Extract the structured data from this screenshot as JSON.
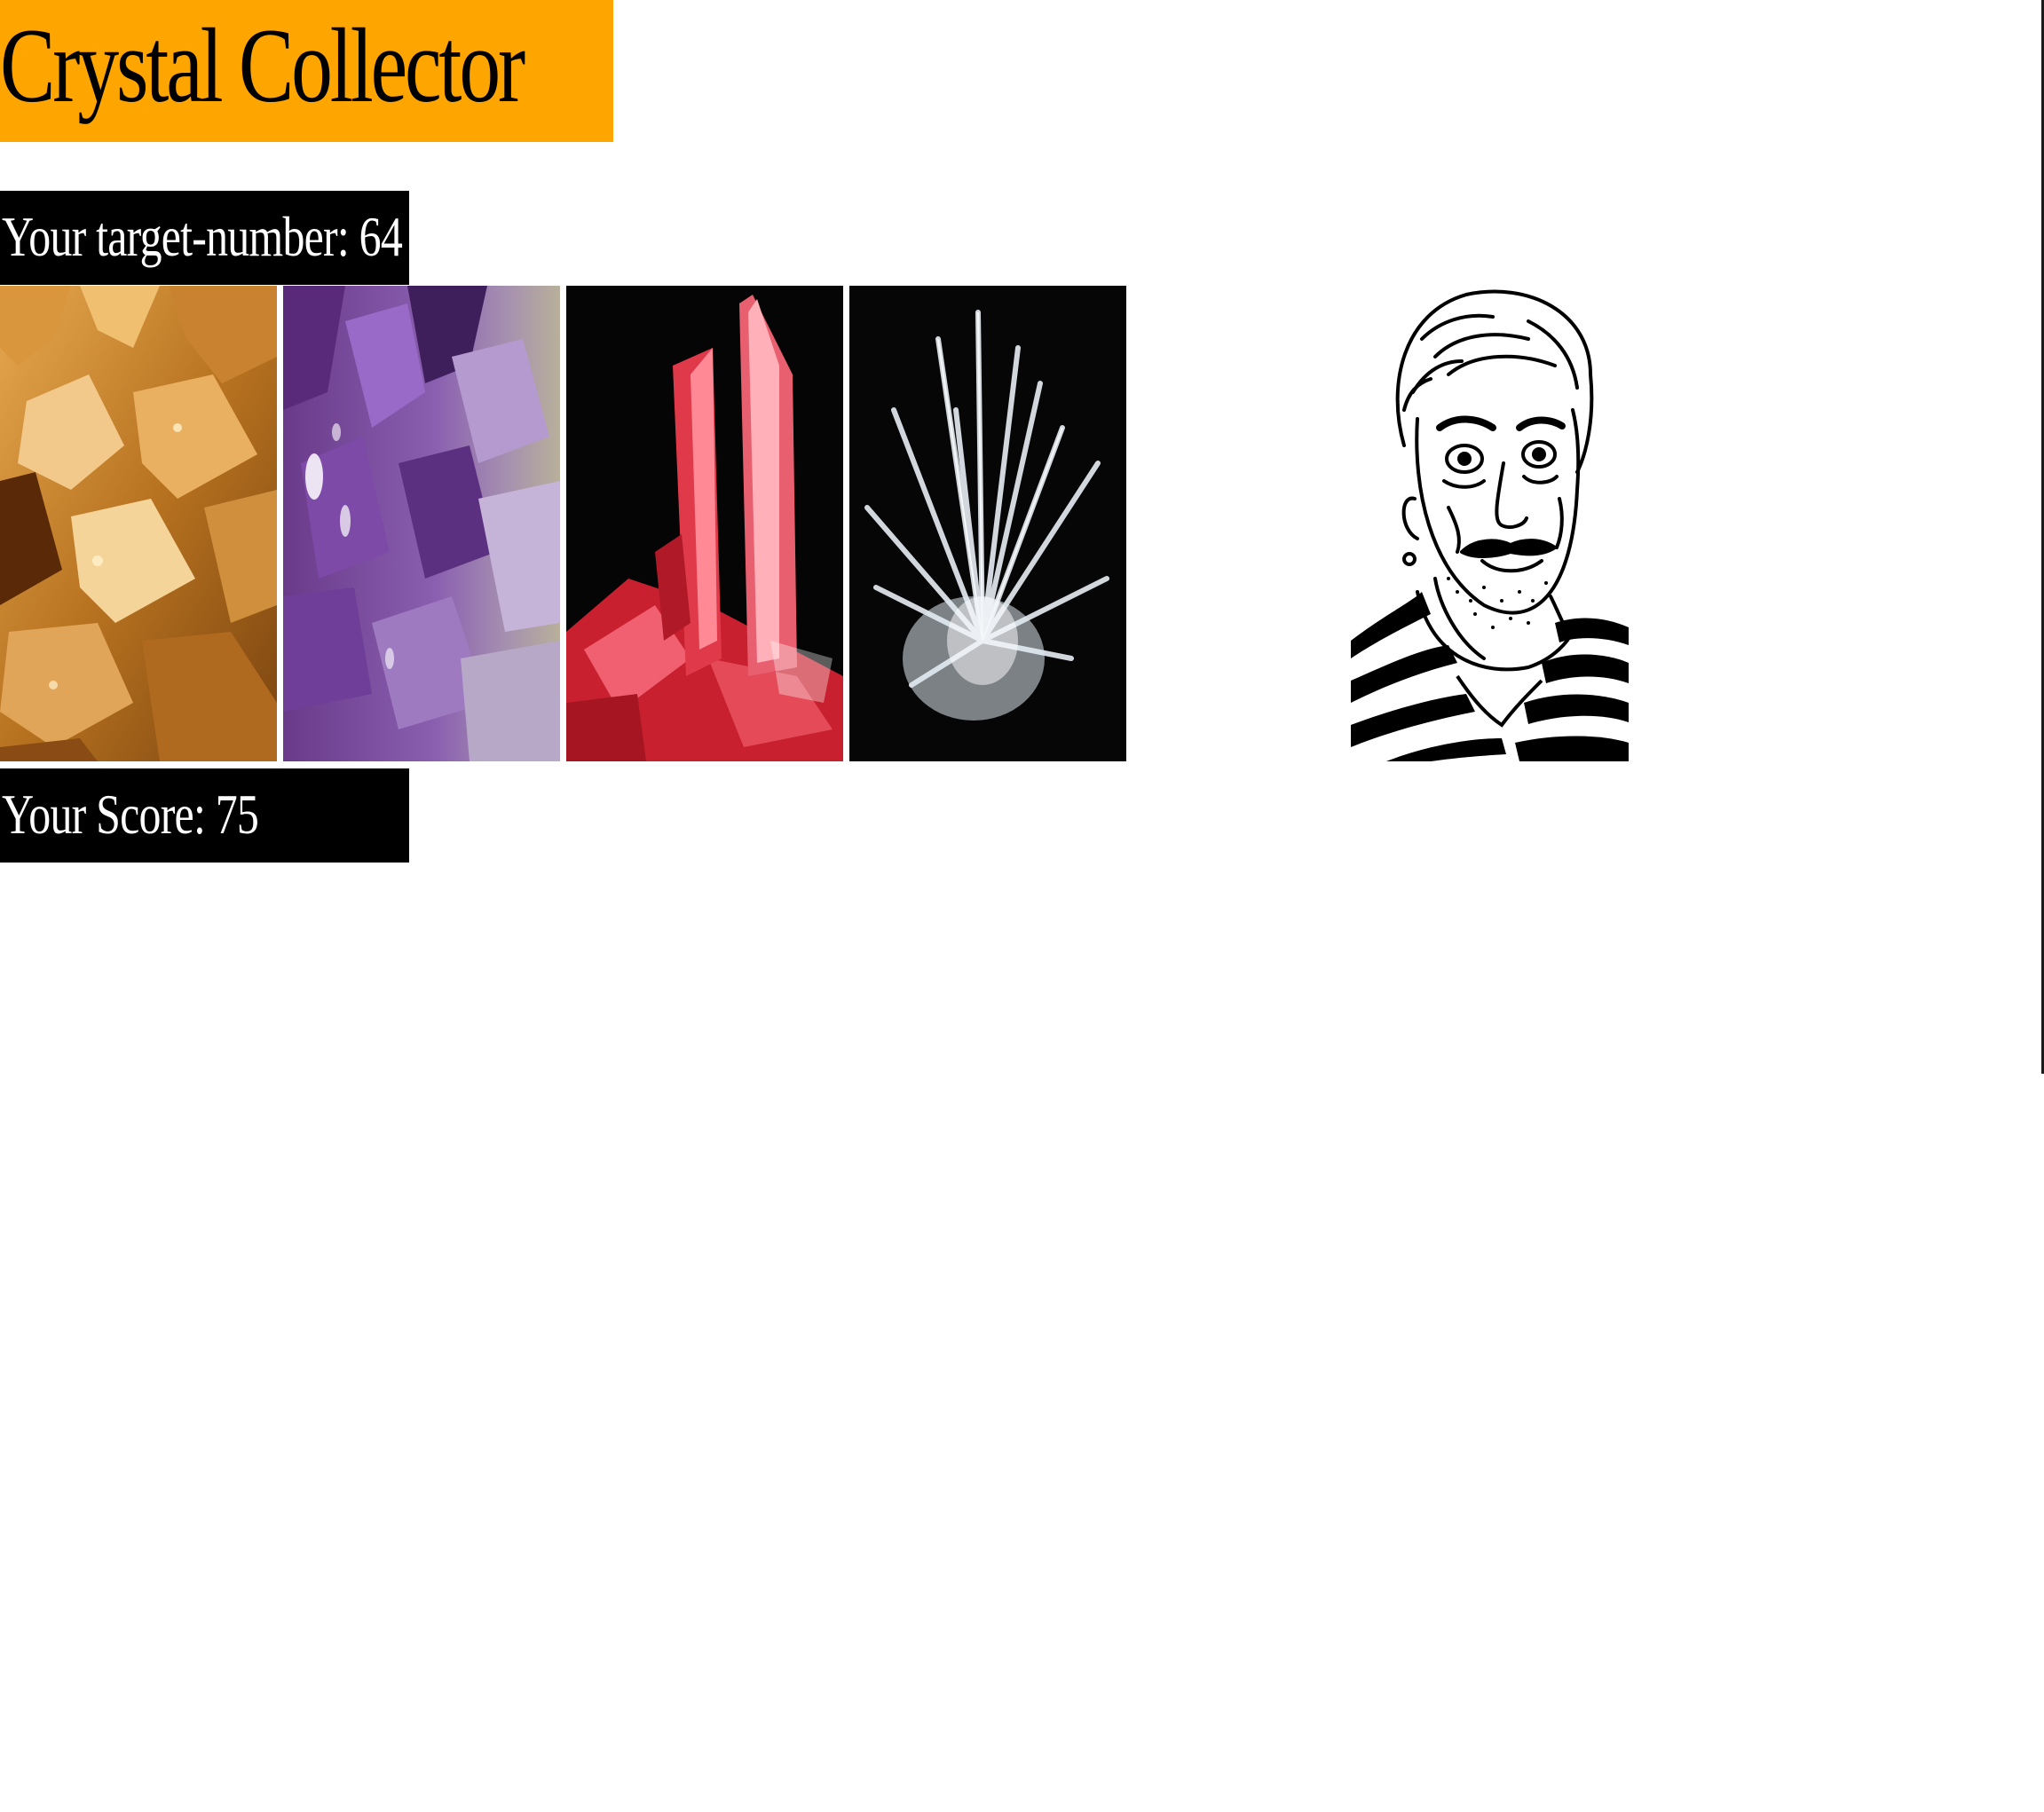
{
  "header": {
    "title": "Crystal Collector"
  },
  "game": {
    "target_label": "Your target-number: 64",
    "score_label": "Your Score: 75"
  },
  "crystals": [
    {
      "icon": "amber-crystal-icon",
      "color": "#c88a2a"
    },
    {
      "icon": "amethyst-crystal-icon",
      "color": "#8b5fa8"
    },
    {
      "icon": "ruby-crystal-icon",
      "color": "#d42a3c"
    },
    {
      "icon": "quartz-crystal-icon",
      "color": "#e6eef5"
    }
  ],
  "colors": {
    "header_bg": "#FFA500",
    "label_bg": "#000000",
    "label_text": "#FFFFFF"
  }
}
